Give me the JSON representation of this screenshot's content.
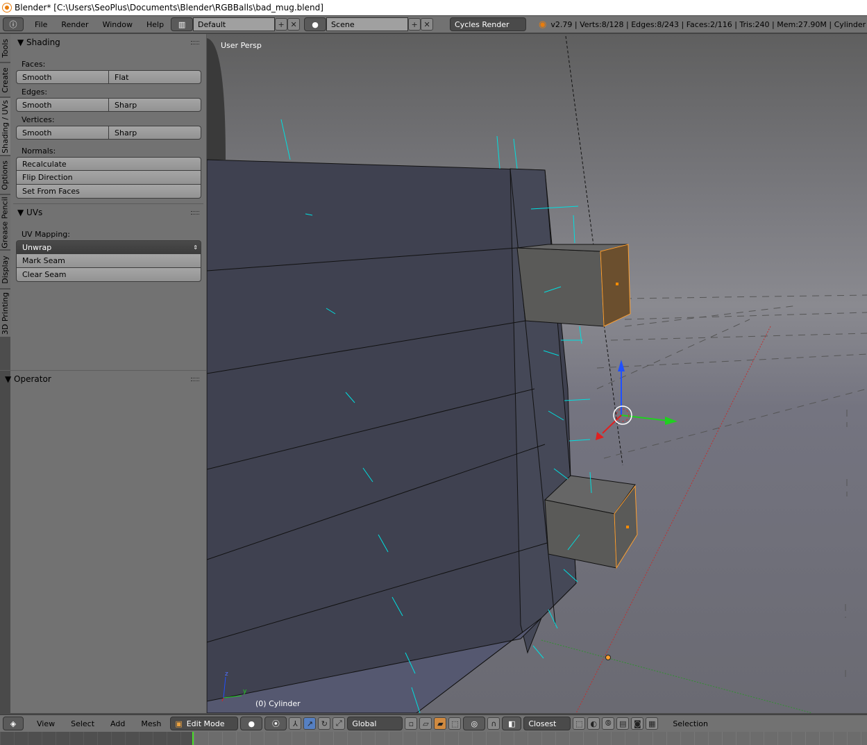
{
  "window": {
    "title": "Blender* [C:\\Users\\SeoPlus\\Documents\\Blender\\RGBBalls\\bad_mug.blend]"
  },
  "topbar": {
    "menus": [
      "File",
      "Render",
      "Window",
      "Help"
    ],
    "layout": "Default",
    "scene": "Scene",
    "engine": "Cycles Render",
    "stats": "v2.79 | Verts:8/128 | Edges:8/243 | Faces:2/116 | Tris:240 | Mem:27.90M | Cylinder"
  },
  "tabs": [
    "Tools",
    "Create",
    "Shading / UVs",
    "Options",
    "Grease Pencil",
    "Display",
    "3D Printing"
  ],
  "active_tab": "Shading / UVs",
  "shading": {
    "title": "Shading",
    "faces_label": "Faces:",
    "faces": [
      "Smooth",
      "Flat"
    ],
    "edges_label": "Edges:",
    "edges": [
      "Smooth",
      "Sharp"
    ],
    "vertices_label": "Vertices:",
    "vertices": [
      "Smooth",
      "Sharp"
    ],
    "normals_label": "Normals:",
    "normals": [
      "Recalculate",
      "Flip Direction",
      "Set From Faces"
    ]
  },
  "uvs": {
    "title": "UVs",
    "mapping_label": "UV Mapping:",
    "unwrap": "Unwrap",
    "buttons": [
      "Mark Seam",
      "Clear Seam"
    ]
  },
  "operator": {
    "title": "Operator"
  },
  "viewport": {
    "view_label": "User Persp",
    "object_label": "(0) Cylinder",
    "axis_y": "y",
    "axis_z": "z",
    "colors": {
      "selected": "#ffa030",
      "normals": "#00e0e0",
      "x_axis": "#e02020",
      "y_axis": "#20d020",
      "z_axis": "#2050ff"
    }
  },
  "bottombar": {
    "menus": [
      "View",
      "Select",
      "Add",
      "Mesh"
    ],
    "mode": "Edit Mode",
    "orientation": "Global",
    "snap": "Closest",
    "selection_label": "Selection"
  }
}
